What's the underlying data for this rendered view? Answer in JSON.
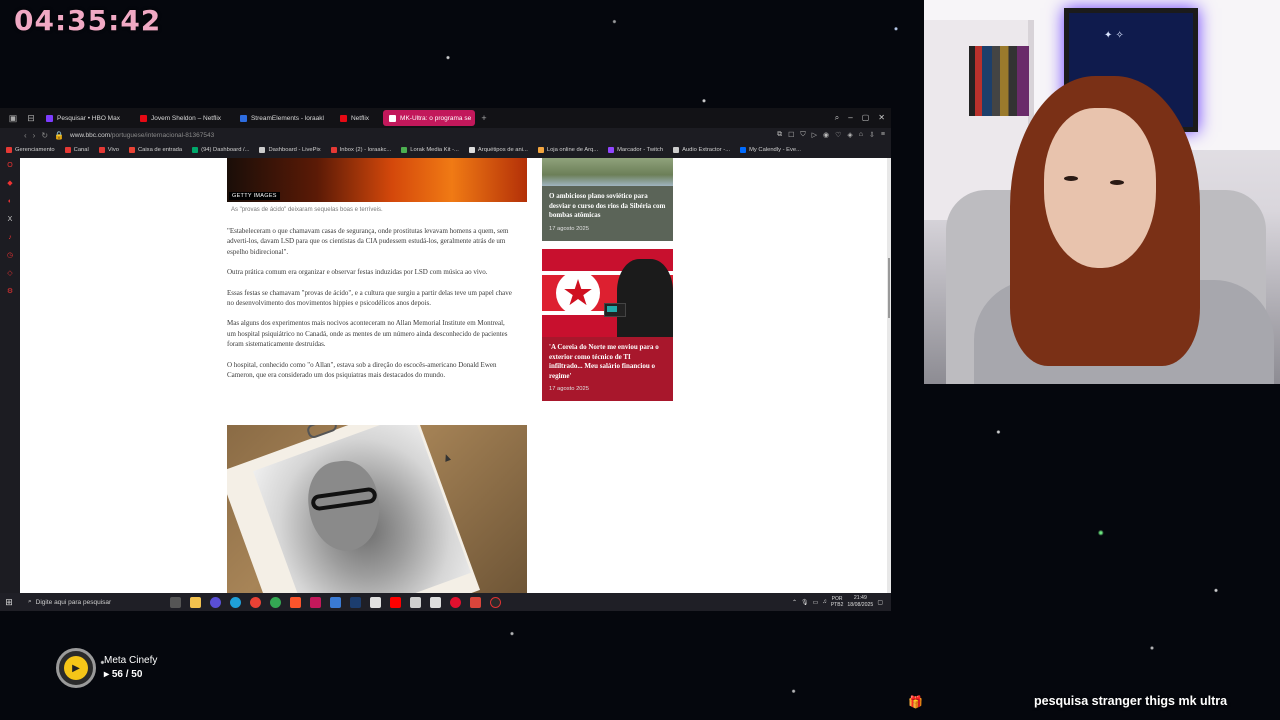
{
  "stream": {
    "clock": "04:35:42",
    "goal": {
      "label": "Meta Cinefy",
      "count": "56 / 50"
    },
    "ticker": "pesquisa stranger thigs mk ultra"
  },
  "browser": {
    "tabs": [
      {
        "label": "Pesquisar • HBO Max",
        "color": "#7d3cff",
        "active": false
      },
      {
        "label": "Jovem Sheldon – Netflix",
        "color": "#e50914",
        "active": false
      },
      {
        "label": "StreamElements - loraakl",
        "color": "#2d6cdf",
        "active": false
      },
      {
        "label": "Netflix",
        "color": "#e50914",
        "active": false
      },
      {
        "label": "MK-Ultra: o programa se",
        "color": "#ffffff",
        "active": true
      }
    ],
    "url_host": "www.bbc.com",
    "url_path": "/portuguese/internacional-81367543",
    "bookmarks": [
      {
        "label": "Gerenciamento",
        "color": "#e53935"
      },
      {
        "label": "Canal",
        "color": "#e53935"
      },
      {
        "label": "Vivo",
        "color": "#e53935"
      },
      {
        "label": "Caixa de entrada",
        "color": "#ea4335"
      },
      {
        "label": "(94) Dashboard /...",
        "color": "#00a86b"
      },
      {
        "label": "Dashboard - LivePix",
        "color": "#cccccc"
      },
      {
        "label": "Inbox (2) - loraakc...",
        "color": "#e53935"
      },
      {
        "label": "Lorak Media Kit -...",
        "color": "#4caf50"
      },
      {
        "label": "Arquétipos de ani...",
        "color": "#dddddd"
      },
      {
        "label": "Loja online de Arq...",
        "color": "#f4a640"
      },
      {
        "label": "Marcador - Twitch",
        "color": "#9146ff"
      },
      {
        "label": "Audio Extractor -...",
        "color": "#cccccc"
      },
      {
        "label": "My Calendly - Eve...",
        "color": "#006bff"
      }
    ]
  },
  "article": {
    "image_credit": "GETTY IMAGES",
    "caption": "As \"provas de ácido\" deixaram sequelas boas e terríveis.",
    "paragraphs": [
      "\"Estabeleceram o que chamavam casas de segurança, onde prostitutas levavam homens a quem, sem adverti-los, davam LSD para que os cientistas da CIA pudessem estudá-los, geralmente atrás de um espelho bidirecional\".",
      "Outra prática comum era organizar e observar festas induzidas por LSD com música ao vivo.",
      "Essas festas se chamavam \"provas de ácido\", e a cultura que surgiu a partir delas teve um papel chave no desenvolvimento dos movimentos hippies e psicodélicos anos depois.",
      "Mas alguns dos experimentos mais nocivos aconteceram no Allan Memorial Institute em Montreal, um hospital psiquiátrico no Canadá, onde as mentes de um número ainda desconhecido de pacientes foram sistematicamente destruídas.",
      "O hospital, conhecido como \"o Allan\", estava sob a direção do escocês-americano Donald Ewen Cameron, que era considerado um dos psiquiatras mais destacados do mundo."
    ]
  },
  "sidebar_cards": [
    {
      "title": "O ambicioso plano soviético para desviar o curso dos rios da Sibéria com bombas atômicas",
      "date": "17 agosto 2025"
    },
    {
      "title": "'A Coreia do Norte me enviou para o exterior como técnico de TI infiltrado... Meu salário financiou o regime'",
      "date": "17 agosto 2025"
    }
  ],
  "taskbar": {
    "search_placeholder": "Digite aqui para pesquisar",
    "lang": "POR",
    "lang2": "PTB2",
    "time": "21:49",
    "date": "18/08/2025"
  }
}
